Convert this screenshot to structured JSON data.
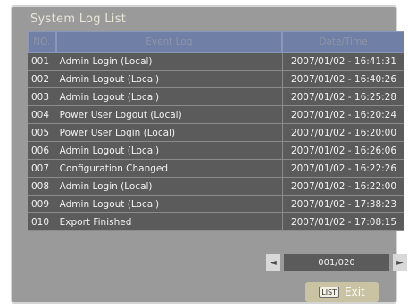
{
  "title": "System Log List",
  "columns": {
    "no": "NO.",
    "event": "Event Log",
    "datetime": "Date/Time"
  },
  "rows": [
    {
      "no": "001",
      "event": "Admin Login (Local)",
      "datetime": "2007/01/02 - 16:41:31"
    },
    {
      "no": "002",
      "event": "Admin Logout (Local)",
      "datetime": "2007/01/02 - 16:40:26"
    },
    {
      "no": "003",
      "event": "Admin Logout (Local)",
      "datetime": "2007/01/02 - 16:25:28"
    },
    {
      "no": "004",
      "event": "Power User Logout (Local)",
      "datetime": "2007/01/02 - 16:20:24"
    },
    {
      "no": "005",
      "event": "Power User Login (Local)",
      "datetime": "2007/01/02 - 16:20:00"
    },
    {
      "no": "006",
      "event": "Admin Logout (Local)",
      "datetime": "2007/01/02 - 16:26:06"
    },
    {
      "no": "007",
      "event": "Configuration Changed",
      "datetime": "2007/01/02 - 16:22:26"
    },
    {
      "no": "008",
      "event": "Admin Login (Local)",
      "datetime": "2007/01/02 - 16:22:00"
    },
    {
      "no": "009",
      "event": "Admin Logout (Local)",
      "datetime": "2007/01/02 - 17:38:23"
    },
    {
      "no": "010",
      "event": "Export Finished",
      "datetime": "2007/01/02 - 17:08:15"
    }
  ],
  "pager": {
    "prev_icon": "◄",
    "next_icon": "►",
    "page": "001/020"
  },
  "exit": {
    "key": "LIST",
    "label": "Exit"
  }
}
